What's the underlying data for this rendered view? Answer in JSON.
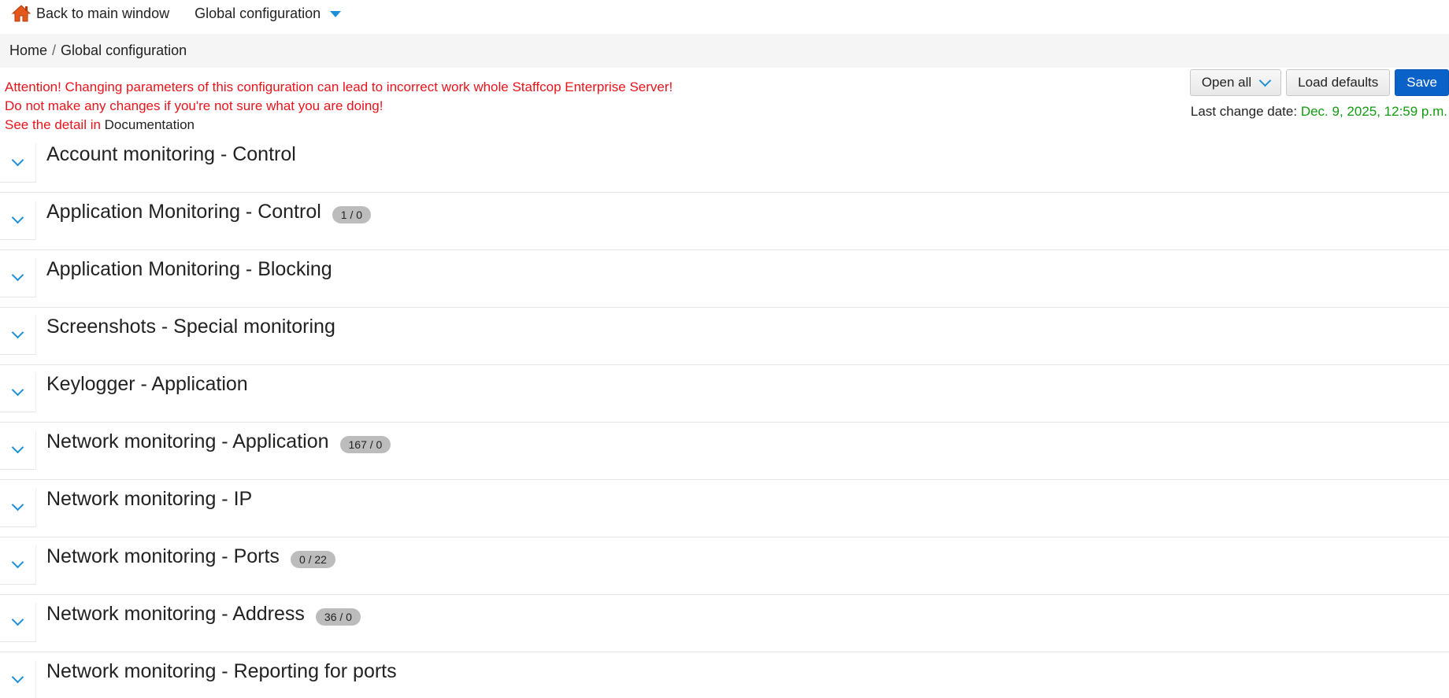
{
  "topbar": {
    "back_label": "Back to main window",
    "config_label": "Global configuration"
  },
  "breadcrumb": {
    "home": "Home",
    "separator": "/",
    "current": "Global configuration"
  },
  "warning": {
    "line1": "Attention! Changing parameters of this configuration can lead to incorrect work whole Staffcop Enterprise Server!",
    "line2": "Do not make any changes if you're not sure what you are doing!",
    "line3_prefix": "See the detail in",
    "doc_link": "Documentation"
  },
  "actions": {
    "open_all": "Open all",
    "load_defaults": "Load defaults",
    "save": "Save"
  },
  "last_change": {
    "label": "Last change date:",
    "date": "Dec. 9, 2025, 12:59 p.m."
  },
  "colors": {
    "warning": "#e8141c",
    "accent": "#1e90d6",
    "date": "#129b12",
    "primary": "#0a62c8"
  },
  "sections": [
    {
      "title": "Account monitoring - Control",
      "badge": ""
    },
    {
      "title": "Application Monitoring - Control",
      "badge": "1 / 0"
    },
    {
      "title": "Application Monitoring - Blocking",
      "badge": ""
    },
    {
      "title": "Screenshots - Special monitoring",
      "badge": ""
    },
    {
      "title": "Keylogger - Application",
      "badge": ""
    },
    {
      "title": "Network monitoring - Application",
      "badge": "167 / 0"
    },
    {
      "title": "Network monitoring - IP",
      "badge": ""
    },
    {
      "title": "Network monitoring - Ports",
      "badge": "0 / 22"
    },
    {
      "title": "Network monitoring - Address",
      "badge": "36 / 0"
    },
    {
      "title": "Network monitoring - Reporting for ports",
      "badge": ""
    }
  ]
}
